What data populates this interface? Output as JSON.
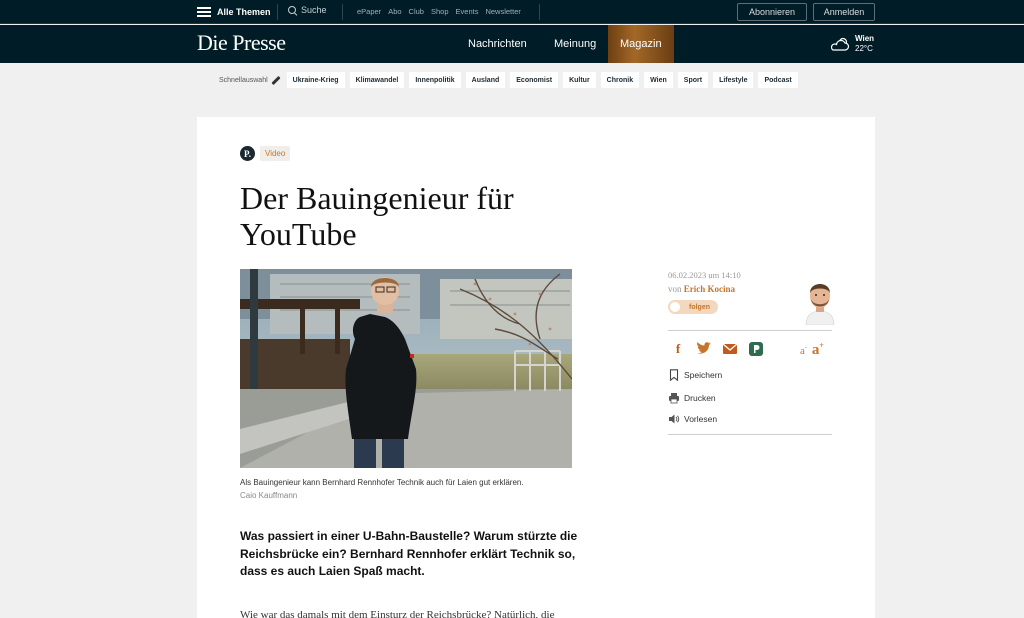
{
  "topbar": {
    "menu_label": "Alle Themen",
    "search_label": "Suche",
    "links": [
      "ePaper",
      "Abo",
      "Club",
      "Shop",
      "Events",
      "Newsletter"
    ],
    "subscribe_label": "Abonnieren",
    "login_label": "Anmelden"
  },
  "nav": {
    "logo": "Die Presse",
    "items": [
      "Nachrichten",
      "Meinung",
      "Magazin"
    ],
    "active": "Magazin",
    "weather_city": "Wien",
    "weather_temp": "22°C"
  },
  "quick": {
    "label": "Schnellauswahl",
    "chips": [
      "Ukraine-Krieg",
      "Klimawandel",
      "Innenpolitik",
      "Ausland",
      "Economist",
      "Kultur",
      "Chronik",
      "Wien",
      "Sport",
      "Lifestyle",
      "Podcast"
    ]
  },
  "article": {
    "badge_logo": "P.",
    "badge": "Video",
    "title": "Der Bauingenieur für YouTube",
    "caption": "Als Bauingenieur kann Bernhard Rennhofer Technik auch für Laien gut erklären.",
    "credit": "Caio Kauffmann",
    "lead": "Was passiert in einer U-Bahn-Baustelle? Warum stürzte die Reichsbrücke ein? Bernhard Rennhofer erklärt Technik so, dass es auch Laien Spaß macht.",
    "body_start": "Wie war das damals mit dem Einsturz der Reichsbrücke? Natürlich, die"
  },
  "sidebar": {
    "date": "06.02.2023 um 14:10",
    "author_prefix": "von",
    "author": "Erich Kocina",
    "follow_label": "folgen",
    "font_small": "a",
    "font_large": "a",
    "actions": [
      "Speichern",
      "Drucken",
      "Vorlesen"
    ]
  },
  "colors": {
    "navy": "#001c26",
    "accent": "#c7742a",
    "facebook": "#c25a1c",
    "twitter": "#c7742a"
  }
}
